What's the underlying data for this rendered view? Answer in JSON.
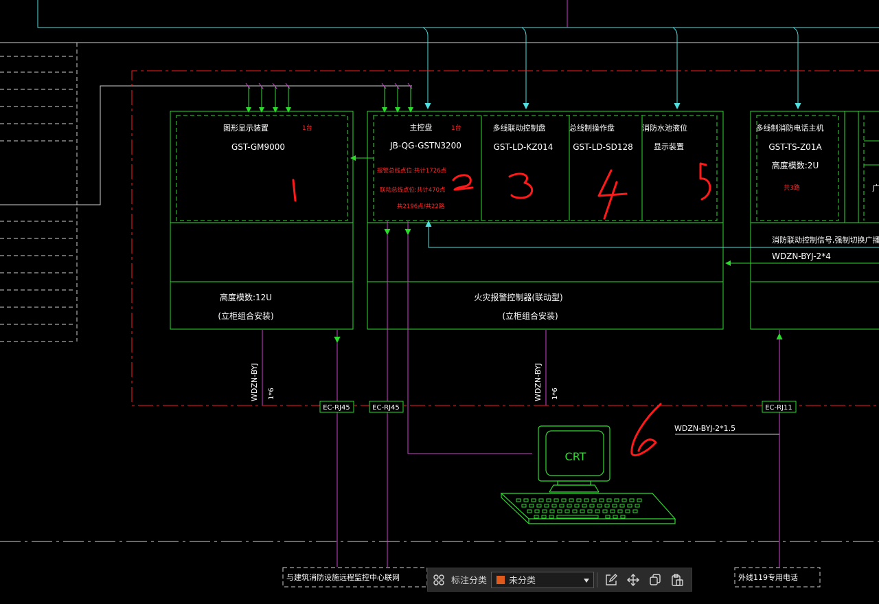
{
  "diagram": {
    "panels": {
      "p1": {
        "title": "图形显示装置",
        "qty": "1台",
        "model": "GST-GM9000",
        "capacity": "高度模数:12U",
        "mount": "(立柜组合安装)",
        "handmark": "1"
      },
      "p2": {
        "title": "主控盘",
        "qty": "1台",
        "model": "JB-QG-GSTN3200",
        "note1": "报警总线点位:共计1726点",
        "note2": "联动总线点位:共计470点",
        "note3": "共2196点/共22路",
        "handmark": "2"
      },
      "p3": {
        "title": "多线联动控制盘",
        "model": "GST-LD-KZ014",
        "handmark": "3"
      },
      "p4": {
        "title": "总线制操作盘",
        "model": "GST-LD-SD128",
        "handmark": "4"
      },
      "p5": {
        "title": "消防水池液位",
        "subtitle": "显示装置",
        "handmark": "5"
      },
      "p6": {
        "title": "多线制消防电话主机",
        "model": "GST-TS-Z01A",
        "capacity": "高度模数:2U",
        "note": "共3路"
      },
      "p7": {
        "partial": "广"
      }
    },
    "cabinet_title": "火灾报警控制器(联动型)",
    "cabinet_mount": "(立柜组合安装)",
    "right_note": "消防联动控制信号,强制切换广播输出线路",
    "right_cable": "WDZN-BYJ-2*4",
    "cable_v1": "WDZN-BYJ",
    "cable_v1b": "1*6",
    "cable_v2": "WDZN-BYJ",
    "cable_v2b": "1*6",
    "box_ec1": "EC-RJ45",
    "box_ec2": "EC-RJ45",
    "box_ec3": "EC-RJ11",
    "crt_cable": "WDZN-BYJ-2*1.5",
    "crt_label": "CRT",
    "handmark6": "6",
    "bottom_left": "与建筑消防设施远程监控中心联网",
    "bottom_right": "外线119专用电话"
  },
  "toolbar": {
    "category_label": "标注分类",
    "selected_value": "未分类",
    "swatch_color": "#e05a1c",
    "icons": [
      "grid-icon",
      "edit-icon",
      "move-icon",
      "copy-icon",
      "paste-icon"
    ]
  },
  "colors": {
    "green": "#2cdc2c",
    "cyan": "#4fe0e0",
    "red": "#ff1a1a",
    "magenta": "#d040d0",
    "white": "#ffffff",
    "bg": "#000000"
  }
}
